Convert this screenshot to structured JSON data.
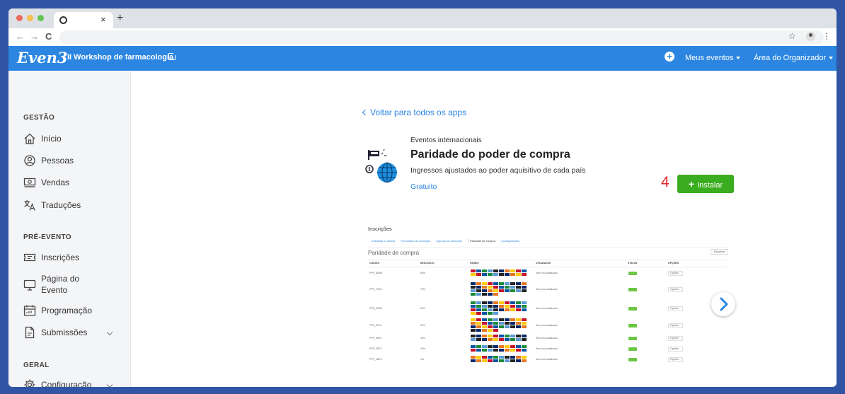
{
  "browser": {
    "new_tab_glyph": "+",
    "tab_close_glyph": "×",
    "back_glyph": "←",
    "forward_glyph": "→",
    "reload_glyph": "C",
    "star_glyph": "☆",
    "menu_glyph": "⋮",
    "traffic_colors": [
      "#ed6a5e",
      "#f5bf4f",
      "#61c554"
    ]
  },
  "appbar": {
    "logo": "Even3",
    "event_name": "II Workshop de farmacologia",
    "plus_glyph": "+",
    "my_events": "Meus eventos",
    "organizer_area": "Área do Organizador"
  },
  "sidebar": {
    "sections": [
      {
        "title": "GESTÃO",
        "items": [
          {
            "label": "Início",
            "icon": "home-icon"
          },
          {
            "label": "Pessoas",
            "icon": "user-circle-icon"
          },
          {
            "label": "Vendas",
            "icon": "money-icon"
          },
          {
            "label": "Traduções",
            "icon": "translate-icon"
          }
        ]
      },
      {
        "title": "PRÉ-EVENTO",
        "items": [
          {
            "label": "Inscrições",
            "icon": "ticket-icon"
          },
          {
            "label": "Página do",
            "label2": "Evento",
            "icon": "monitor-icon"
          },
          {
            "label": "Programação",
            "icon": "calendar-icon"
          },
          {
            "label": "Submissões",
            "icon": "document-icon",
            "expandable": true
          }
        ]
      },
      {
        "title": "GERAL",
        "items": [
          {
            "label": "Configuração",
            "icon": "gear-icon",
            "expandable": true
          }
        ]
      }
    ]
  },
  "main": {
    "back_link": "Voltar para todos os apps",
    "app": {
      "category": "Eventos internacionais",
      "title": "Paridade do poder de compra",
      "description": "Ingressos ajustados ao poder aquisitivo de cada país",
      "price": "Gratuito",
      "icon": "globe-flag-icon"
    },
    "step_number": "4",
    "install_button": {
      "plus": "+",
      "label": "Instalar",
      "color": "#3aac1f"
    },
    "preview": {
      "title": "Inscrições",
      "tabs": [
        "Entradas e valores",
        "Formulário de inscrição",
        "Cupons de desconto",
        "Paridade de compra",
        "Configurações"
      ],
      "active_tab": 3,
      "subtitle": "Paridade de compra",
      "export_label": "Exportar",
      "columns": [
        "CÓDIGO",
        "DESCONTO",
        "PAÍSES",
        "UTILIZADOS",
        "STATUS",
        "OPÇÕES"
      ],
      "rows": [
        {
          "code": "PPP_8DM4",
          "discount": "80%",
          "used": "Sem uso atualizado",
          "option": "Opções",
          "flag_rows": 2
        },
        {
          "code": "PPP_7KS3",
          "discount": "70%",
          "used": "Sem uso atualizado",
          "option": "Opções",
          "flag_rows": 4
        },
        {
          "code": "PPP_6GN9",
          "discount": "60%",
          "used": "Sem uso atualizado",
          "option": "Opções",
          "flag_rows": 4
        },
        {
          "code": "PPP_5TX4",
          "discount": "50%",
          "used": "Sem uso atualizado",
          "option": "Opções",
          "flag_rows": 4
        },
        {
          "code": "PPP_3BT5",
          "discount": "30%",
          "used": "Sem uso atualizado",
          "option": "Opções",
          "flag_rows": 2
        },
        {
          "code": "PPP_2RP1",
          "discount": "20%",
          "used": "Sem uso atualizado",
          "option": "Opções",
          "flag_rows": 2
        },
        {
          "code": "PPP_1BKX",
          "discount": "0%",
          "used": "Sem uso atualizado",
          "option": "Opções",
          "flag_rows": 2
        }
      ]
    }
  }
}
